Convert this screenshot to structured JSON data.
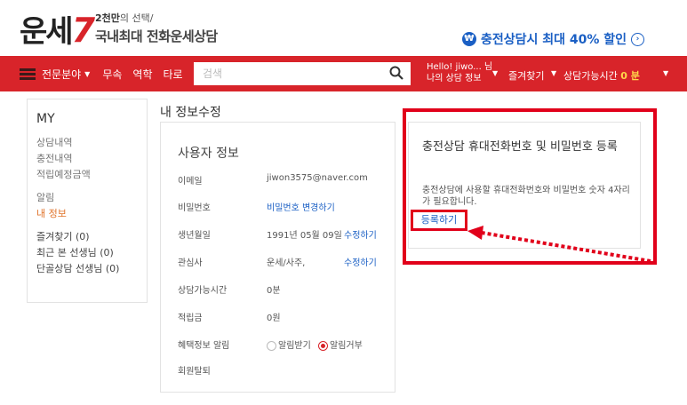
{
  "header": {
    "logo_text": "운세",
    "logo_number": "7",
    "tagline_small_bold": "2천만",
    "tagline_small_rest": "의 선택/",
    "tagline_big": "국내최대 전화운세상담",
    "promo_icon": "₩",
    "promo_text": "충전상담시 최대 40% 할인",
    "promo_arrow": "›"
  },
  "nav": {
    "category_menu": "전문분야",
    "items": [
      "무속",
      "역학",
      "타로"
    ],
    "search_placeholder": "검색",
    "user_line1": "Hello! jiwo... 님",
    "user_line2": "나의 상담 정보",
    "favorites": "즐겨찾기",
    "available_label": "상담가능시간",
    "available_value": "0 분",
    "dropdown_glyph": "▼"
  },
  "sidebar": {
    "title": "MY",
    "group1": [
      "상담내역",
      "충전내역",
      "적립예정금액"
    ],
    "group2": [
      "알림",
      "내 정보"
    ],
    "group3": [
      "즐겨찾기 (0)",
      "최근 본 선생님 (0)",
      "단골상담 선생님 (0)"
    ]
  },
  "main": {
    "page_title": "내 정보수정",
    "card_heading": "사용자 정보",
    "email_label": "이메일",
    "email_value": "jiwon3575@naver.com",
    "password_label": "비밀번호",
    "password_action": "비밀번호 변경하기",
    "birth_label": "생년월일",
    "birth_value": "1991년 05월 09일",
    "birth_action": "수정하기",
    "interest_label": "관심사",
    "interest_value": "운세/사주,",
    "interest_action": "수정하기",
    "available_label": "상담가능시간",
    "available_value": "0분",
    "points_label": "적립금",
    "points_value": "0원",
    "marketing_label": "혜택정보 알림",
    "marketing_opt_in": "알림받기",
    "marketing_opt_out": "알림거부",
    "marketing_selected": "알림거부",
    "withdraw_label": "회원탈퇴"
  },
  "panel": {
    "title": "충전상담 휴대전화번호 및 비밀번호 등록",
    "description": "충전상담에 사용할 휴대전화번호와 비밀번호 숫자 4자리가 필요합니다.",
    "register_button": "등록하기"
  },
  "colors": {
    "brand_red": "#d8242a",
    "link_blue": "#1a5fc4",
    "highlight_red": "#e1001a",
    "active_orange": "#e0732a"
  }
}
